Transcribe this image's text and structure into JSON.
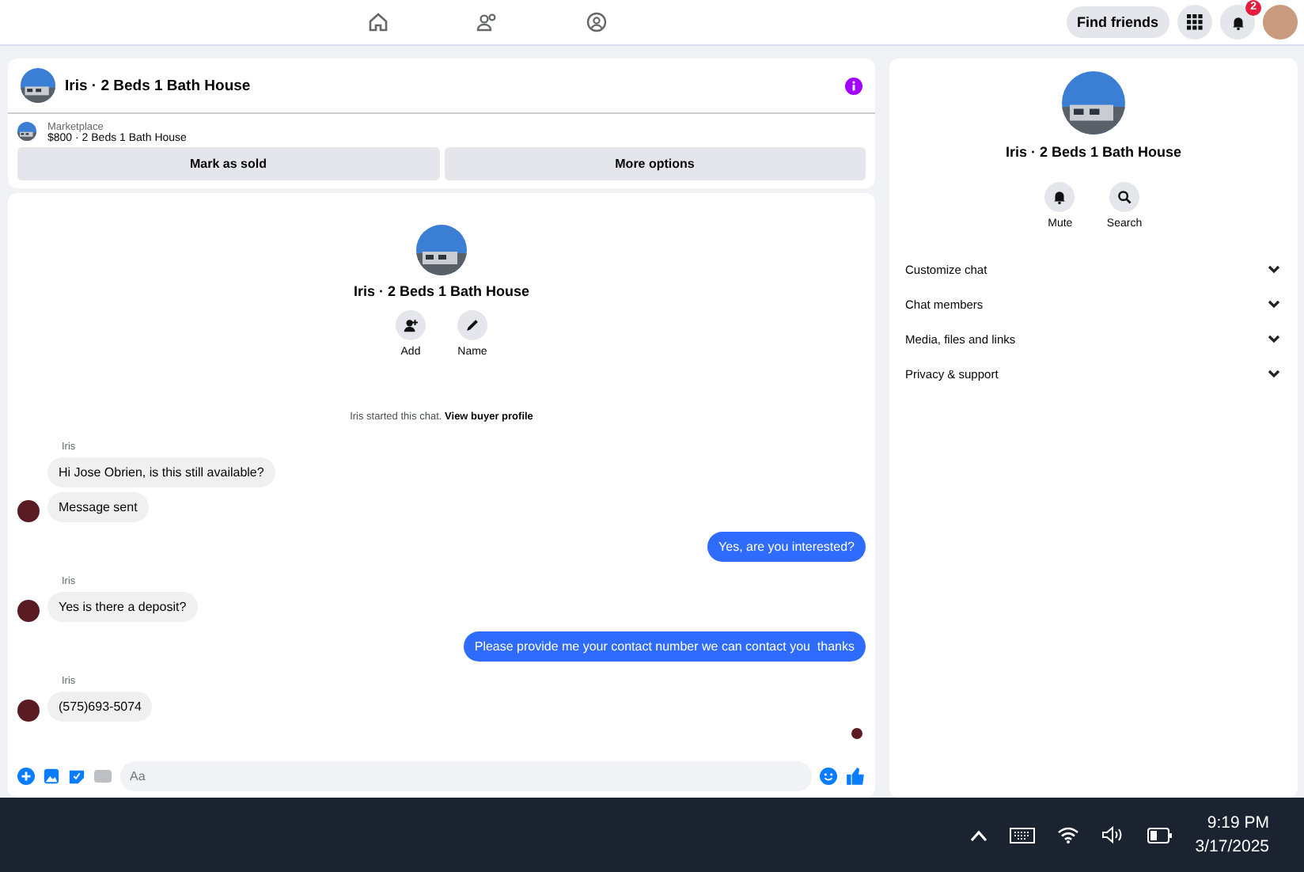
{
  "topbar": {
    "find_friends": "Find friends",
    "notification_count": "2"
  },
  "listing_header": {
    "title": "Iris · 2 Beds 1 Bath House",
    "marketplace_label": "Marketplace",
    "price_line": "$800 · 2 Beds 1 Bath House",
    "buttons": [
      "Mark as sold",
      "More options"
    ]
  },
  "chat_intro": {
    "title": "Iris · 2 Beds 1 Bath House",
    "actions": [
      {
        "kind": "add",
        "label": "Add"
      },
      {
        "kind": "name",
        "label": "Name"
      }
    ],
    "started_text": "Iris started this chat.",
    "profile_link": "View buyer profile"
  },
  "messages": [
    {
      "kind": "incoming",
      "sender": "Iris",
      "text": "Hi Jose Obrien, is this still available?",
      "avatar": false
    },
    {
      "kind": "incoming",
      "text": "Message sent",
      "avatar": true
    },
    {
      "kind": "outgoing",
      "text": "Yes, are you interested?"
    },
    {
      "kind": "incoming",
      "sender": "Iris",
      "text": "Yes is there a deposit?",
      "avatar": true
    },
    {
      "kind": "outgoing",
      "text": "Please provide me your contact number we can contact you  thanks"
    },
    {
      "kind": "incoming",
      "sender": "Iris",
      "text": "(575)693-5074",
      "avatar": true
    }
  ],
  "composer": {
    "placeholder": "Aa"
  },
  "details": {
    "title": "Iris · 2 Beds 1 Bath House",
    "actions": [
      {
        "kind": "mute",
        "label": "Mute"
      },
      {
        "kind": "search",
        "label": "Search"
      }
    ],
    "sections": [
      {
        "label": "Customize chat",
        "expanded": false
      },
      {
        "label": "Chat members",
        "expanded": false
      },
      {
        "label": "Media, files and links",
        "expanded": false
      },
      {
        "label": "Privacy & support",
        "expanded": false
      }
    ]
  },
  "taskbar": {
    "time": "9:19 PM",
    "date": "3/17/2025"
  }
}
